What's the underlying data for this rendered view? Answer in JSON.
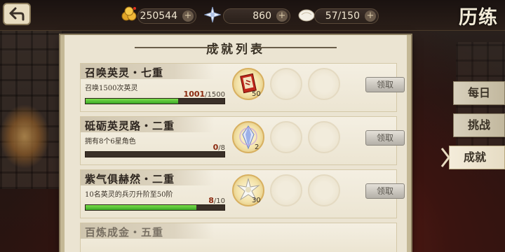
{
  "header": {
    "gold": "250544",
    "stars": "860",
    "stamina": "57/150",
    "title": "历练",
    "plus": "+"
  },
  "panel": {
    "title": "成就列表"
  },
  "achievements": [
    {
      "title": "召唤英灵・七重",
      "desc": "召唤1500次英灵",
      "current": "1001",
      "total": "/1500",
      "progress": 0.667,
      "reward_count": "50",
      "reward_icon": "summon-book-icon",
      "claim": "领取"
    },
    {
      "title": "砥砺英灵路・二重",
      "desc": "拥有8个6星角色",
      "current": "0",
      "total": "/8",
      "progress": 0,
      "reward_count": "2",
      "reward_icon": "crystal-icon",
      "claim": "领取"
    },
    {
      "title": "紫气俱赫然・二重",
      "desc": "10名英灵的兵刃升阶至50阶",
      "current": "8",
      "total": "/10",
      "progress": 0.8,
      "reward_count": "30",
      "reward_icon": "star-shard-icon",
      "claim": "领取"
    },
    {
      "title": "百炼成金・五重"
    }
  ],
  "tabs": [
    {
      "label": "每日",
      "active": false
    },
    {
      "label": "挑战",
      "active": false
    },
    {
      "label": "成就",
      "active": true
    }
  ],
  "colors": {
    "accent_progress": "#3ca828",
    "panel": "#ebe4d2",
    "title_text": "#f4ecd8"
  }
}
